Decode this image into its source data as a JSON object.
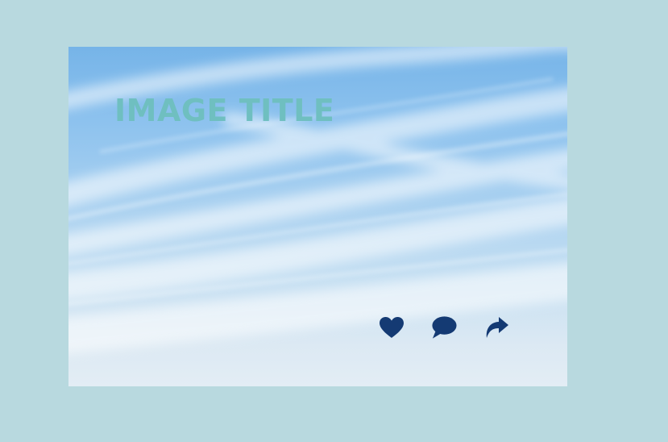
{
  "card": {
    "title": "IMAGE TITLE",
    "background": "sky-with-clouds-photo"
  },
  "actions": [
    {
      "icon": "heart-icon",
      "name": "like"
    },
    {
      "icon": "speech-bubble-icon",
      "name": "comment"
    },
    {
      "icon": "share-arrow-icon",
      "name": "share"
    }
  ],
  "colors": {
    "page_background": "#b8d9df",
    "title": "#6fbfc0",
    "icons": "#143a73"
  }
}
